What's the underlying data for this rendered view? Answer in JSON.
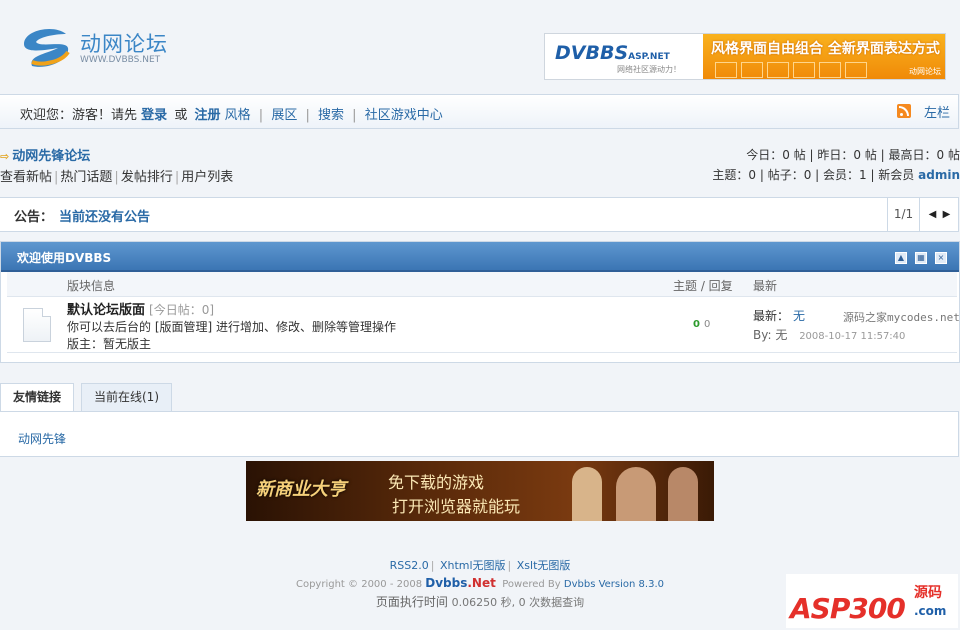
{
  "header": {
    "logo_name": "动网论坛",
    "logo_url": "WWW.DVBBS.NET",
    "banner": {
      "brand": "DVBBS",
      "brand_suffix": "ASP.NET",
      "brand_sub": "网络社区源动力！",
      "slogan": "风格界面自由组合  全新界面表达方式",
      "mini": "动网论坛"
    }
  },
  "nav": {
    "welcome": "欢迎您：游客！请先",
    "login": "登录",
    "or": "或",
    "register": "注册",
    "style": "风格",
    "expand": "展区",
    "search": "搜索",
    "game_center": "社区游戏中心",
    "left_col": "左栏"
  },
  "forum_info": {
    "title": "动网先锋论坛",
    "quicklinks": [
      "查看新帖",
      "热门话题",
      "发帖排行",
      "用户列表"
    ],
    "stats_line1": "今日：0 帖  |  昨日：0 帖  |  最高日：0 帖",
    "stats_line2_prefix": "主题：0  |  帖子：0  |  会员：1  |  新会员",
    "newest_member": "admin"
  },
  "announcement": {
    "label": "公告：",
    "text": "当前还没有公告",
    "page": "1/1"
  },
  "board": {
    "title": "欢迎使用DVBBS",
    "col_info": "版块信息",
    "col_topics": "主题 / 回复",
    "col_last": "最新",
    "forum": {
      "name": "默认论坛版面",
      "today": "[今日帖：0]",
      "description": "你可以去后台的 [版面管理] 进行增加、修改、删除等管理操作",
      "moderator": "版主：暂无版主",
      "topics": "0",
      "replies": "0",
      "last_label": "最新：",
      "last_value": "无",
      "by_label": "By:",
      "by_value": "无",
      "last_date": "2008-10-17 11:57:40",
      "watermark": "源码之家mycodes.net"
    }
  },
  "links": {
    "tab_friends": "友情链接",
    "tab_online": "当前在线(1)",
    "items": [
      "动网先锋"
    ]
  },
  "game_ad": {
    "logo": "新商业大亨",
    "line1": "免下载的游戏",
    "line2": "打开浏览器就能玩"
  },
  "footer": {
    "links": [
      "RSS2.0",
      "Xhtml无图版",
      "Xslt无图版"
    ],
    "copyright": "Copyright © 2000 - 2008",
    "brand": "Dvbbs",
    "brand_net": ".Net",
    "powered": "Powered By",
    "version": "Dvbbs Version 8.3.0",
    "exec_label": "页面执行时间",
    "exec_value": "0.06250 秒, 0 次数据查询"
  },
  "watermark_logo": {
    "main": "ASP300",
    "side1": "源码",
    "side2": ".com"
  }
}
